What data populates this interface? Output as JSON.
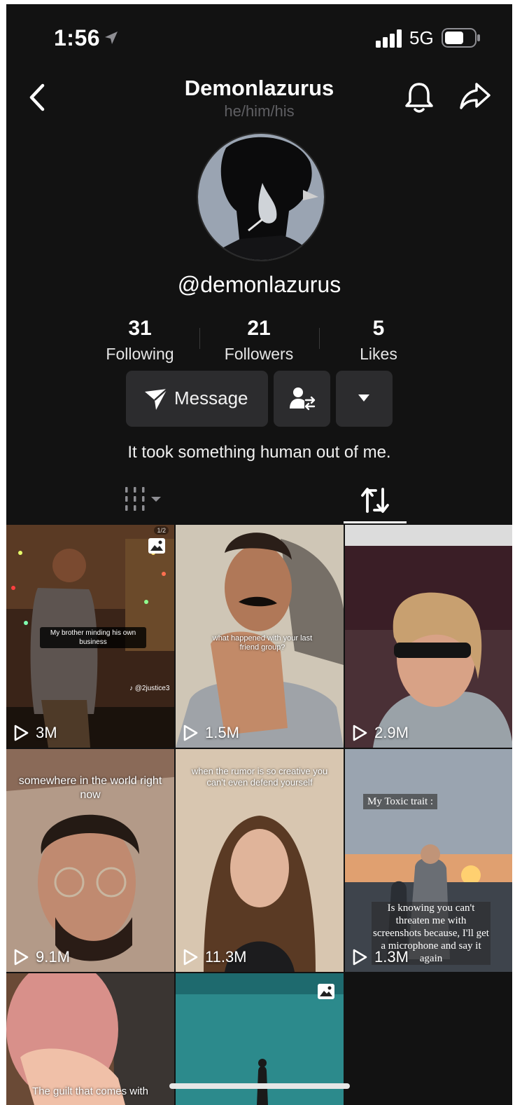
{
  "status_bar": {
    "time": "1:56",
    "network": "5G"
  },
  "header": {
    "title": "Demonlazurus",
    "pronouns": "he/him/his"
  },
  "profile": {
    "handle": "@demonlazurus",
    "bio": "It took something human out of me.",
    "stats": [
      {
        "value": "31",
        "label": "Following"
      },
      {
        "value": "21",
        "label": "Followers"
      },
      {
        "value": "5",
        "label": "Likes"
      }
    ]
  },
  "actions": {
    "message_label": "Message"
  },
  "tabs": {
    "active": "reposts"
  },
  "grid": [
    {
      "views": "3M",
      "caption": "My brother minding his own business",
      "pager": "1/2",
      "watermark": "♪ @2justice3",
      "photo": true
    },
    {
      "views": "1.5M",
      "caption": "what happened with your last friend group?"
    },
    {
      "views": "2.9M"
    },
    {
      "views": "9.1M",
      "caption": "somewhere in the world right now"
    },
    {
      "views": "11.3M",
      "caption": "when the rumor is so creative you can't even defend yourself"
    },
    {
      "views": "1.3M",
      "caption_top": "My Toxic trait :",
      "caption_bottom": "Is knowing you can't threaten me with screenshots because, I'll get a microphone and say it again"
    },
    {
      "caption": "The guilt that comes with"
    },
    {
      "photo": true
    }
  ]
}
